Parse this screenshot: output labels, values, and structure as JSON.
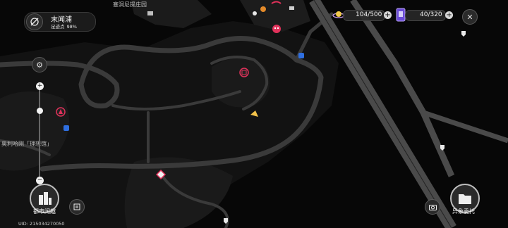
{
  "region": {
    "name": "末闻浦",
    "exploration_label": "足迹点",
    "exploration_value": "98%"
  },
  "resources": [
    {
      "icon": "energy-orb-icon",
      "value": "104/500"
    },
    {
      "icon": "card-pack-icon",
      "value": "40/320"
    }
  ],
  "map_labels": {
    "top": "塞洞尼提庄园",
    "left": "奥利哈刚「理想馆」"
  },
  "buttons": {
    "city_events": "都市闲趣",
    "anomaly_commission": "异象委托"
  },
  "uid": "UID: 215034270050",
  "colors": {
    "road": "#3a3a3a",
    "background": "#070707",
    "accent_red": "#e0315a",
    "accent_blue": "#2f6fe0"
  }
}
